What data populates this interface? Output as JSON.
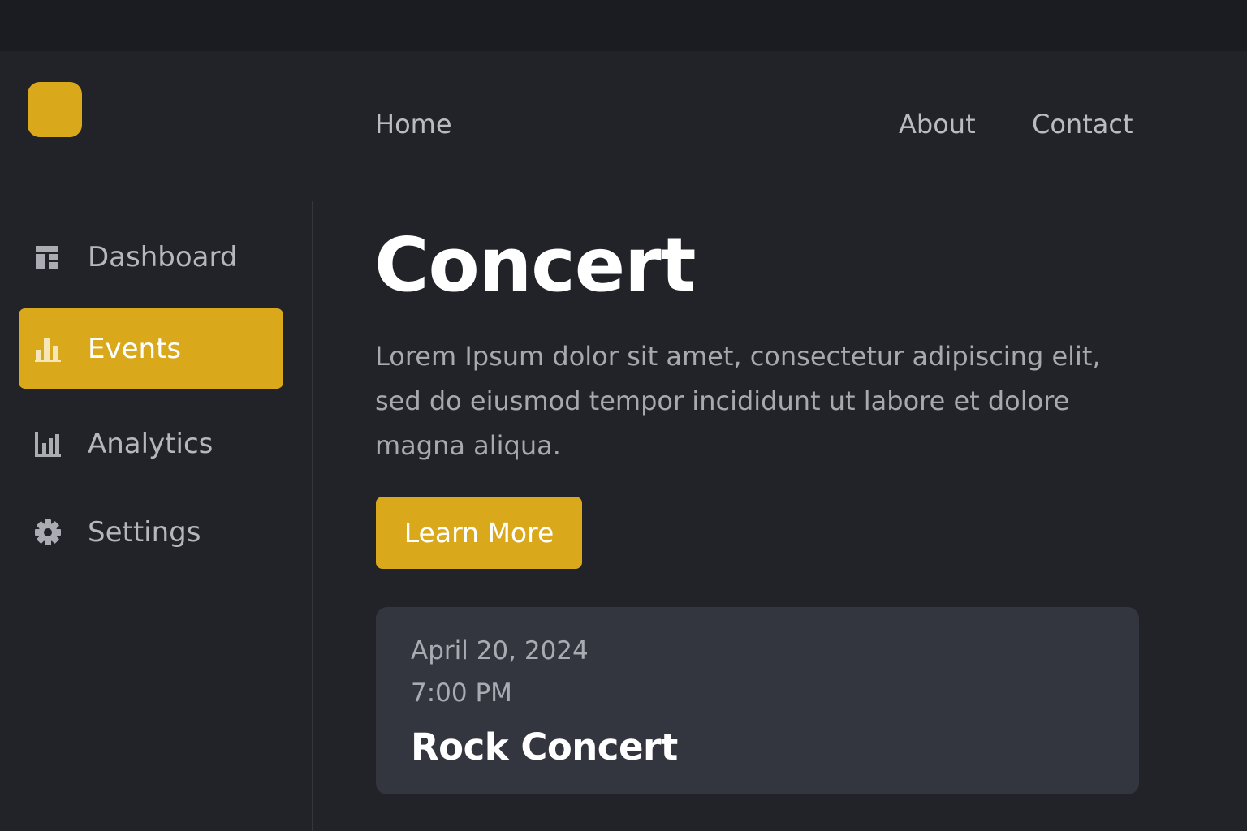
{
  "colors": {
    "accent": "#d9a81b",
    "background": "#222328",
    "topbar": "#1b1c21",
    "card": "#33363e"
  },
  "nav": {
    "home": "Home",
    "about": "About",
    "contact": "Contact"
  },
  "sidebar": {
    "items": [
      {
        "label": "Dashboard",
        "icon": "dashboard-icon",
        "active": false
      },
      {
        "label": "Events",
        "icon": "bar-chart-icon",
        "active": true
      },
      {
        "label": "Analytics",
        "icon": "analytics-icon",
        "active": false
      },
      {
        "label": "Settings",
        "icon": "gear-icon",
        "active": false
      }
    ]
  },
  "main": {
    "title": "Concert",
    "description": "Lorem Ipsum dolor sit amet, consectetur adipiscing elit, sed do eiusmod tempor incididunt ut labore et dolore magna aliqua.",
    "cta_label": "Learn More",
    "event": {
      "date": "April 20, 2024",
      "time": "7:00 PM",
      "name": "Rock Concert"
    }
  }
}
